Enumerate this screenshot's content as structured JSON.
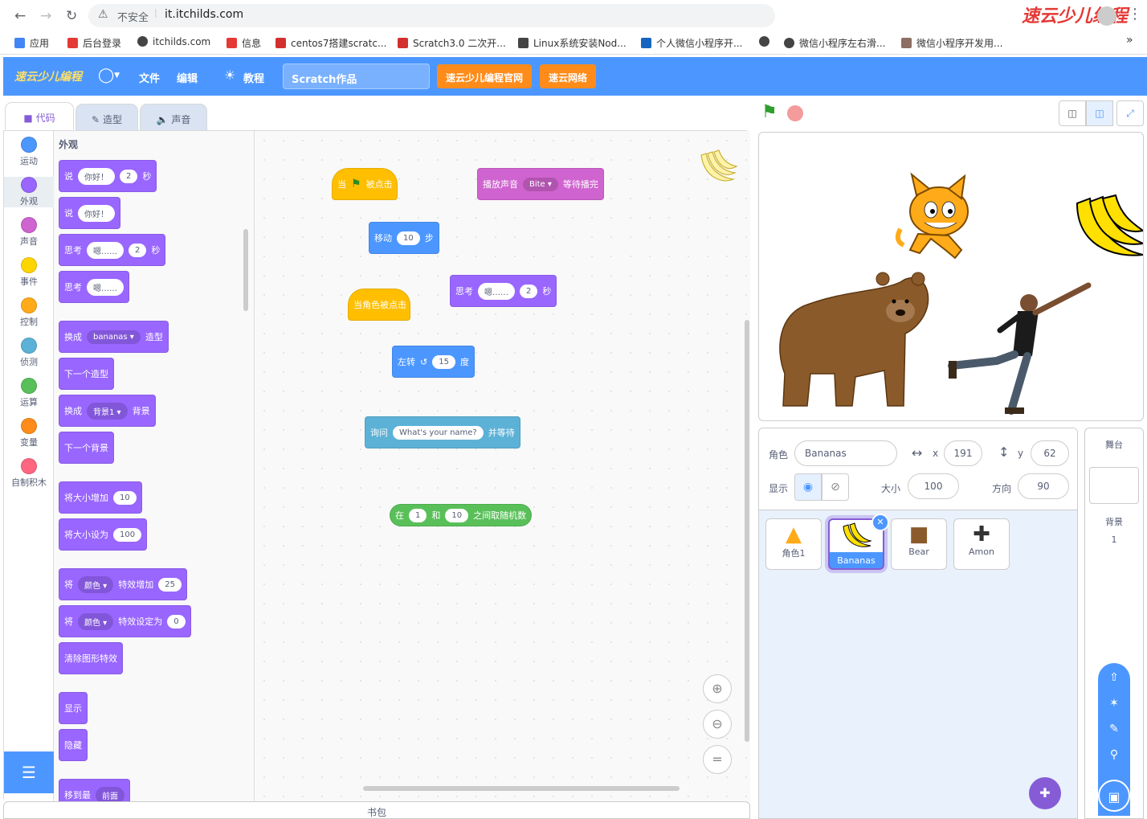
{
  "browser": {
    "security_label": "不安全",
    "url": "it.itchilds.com",
    "bookmarks": [
      {
        "label": "应用",
        "color": "#4285f4"
      },
      {
        "label": "后台登录",
        "color": "#e53935"
      },
      {
        "label": "itchilds.com",
        "color": "#444444"
      },
      {
        "label": "信息",
        "color": "#e53935"
      },
      {
        "label": "centos7搭建scratc...",
        "color": "#d32f2f"
      },
      {
        "label": "Scratch3.0 二次开...",
        "color": "#d32f2f"
      },
      {
        "label": "Linux系统安装Nod...",
        "color": "#444444"
      },
      {
        "label": "个人微信小程序开...",
        "color": "#1565c0"
      },
      {
        "label": "",
        "color": "#444444"
      },
      {
        "label": "微信小程序左右滑...",
        "color": "#444444"
      },
      {
        "label": "微信小程序开发用...",
        "color": "#8d6e63"
      }
    ],
    "more": "»",
    "brand_watermark": "速云少儿编程"
  },
  "menubar": {
    "logo": "速云少儿编程",
    "file": "文件",
    "edit": "编辑",
    "tutorials": "教程",
    "project_title": "Scratch作品",
    "official_site": "速云少儿编程官网",
    "network": "速云网络"
  },
  "tabs": {
    "code": "代码",
    "costumes": "造型",
    "sounds": "声音"
  },
  "categories": [
    {
      "label": "运动",
      "color": "#4c97ff"
    },
    {
      "label": "外观",
      "color": "#9966ff"
    },
    {
      "label": "声音",
      "color": "#cf63cf"
    },
    {
      "label": "事件",
      "color": "#ffd500"
    },
    {
      "label": "控制",
      "color": "#ffab19"
    },
    {
      "label": "侦测",
      "color": "#5cb1d6"
    },
    {
      "label": "运算",
      "color": "#59c059"
    },
    {
      "label": "变量",
      "color": "#ff8c1a"
    },
    {
      "label": "自制积木",
      "color": "#ff6680"
    }
  ],
  "palette": {
    "heading": "外观",
    "say_secs": {
      "a": "说",
      "v1": "你好！",
      "v2": "2",
      "b": "秒"
    },
    "say": {
      "a": "说",
      "v1": "你好！"
    },
    "think_secs": {
      "a": "思考",
      "v1": "嗯……",
      "v2": "2",
      "b": "秒"
    },
    "think": {
      "a": "思考",
      "v1": "嗯……"
    },
    "switch_costume": {
      "a": "换成",
      "v1": "bananas",
      "b": "造型"
    },
    "next_costume": "下一个造型",
    "switch_backdrop": {
      "a": "换成",
      "v1": "背景1",
      "b": "背景"
    },
    "next_backdrop": "下一个背景",
    "change_size": {
      "a": "将大小增加",
      "v1": "10"
    },
    "set_size": {
      "a": "将大小设为",
      "v1": "100"
    },
    "change_effect": {
      "a": "将",
      "v1": "颜色",
      "b": "特效增加",
      "v2": "25"
    },
    "set_effect": {
      "a": "将",
      "v1": "颜色",
      "b": "特效设定为",
      "v2": "0"
    },
    "clear_effects": "清除图形特效",
    "show": "显示",
    "hide": "隐藏",
    "goto_layer": {
      "a": "移到最",
      "v1": "前面"
    }
  },
  "workspace": {
    "flag_hat": {
      "a": "当",
      "b": "被点击"
    },
    "play_sound": {
      "a": "播放声音",
      "v1": "Bite",
      "b": "等待播完"
    },
    "move": {
      "a": "移动",
      "v1": "10",
      "b": "步"
    },
    "think": {
      "a": "思考",
      "v1": "嗯……",
      "v2": "2",
      "b": "秒"
    },
    "sprite_clicked": "当角色被点击",
    "turn_left": {
      "a": "左转",
      "v1": "15",
      "b": "度"
    },
    "ask": {
      "a": "询问",
      "v1": "What's your name?",
      "b": "并等待"
    },
    "random": {
      "a": "在",
      "v1": "1",
      "b": "和",
      "v2": "10",
      "c": "之间取随机数"
    }
  },
  "sprite_info": {
    "sprite_label": "角色",
    "sprite_name": "Bananas",
    "x_label": "x",
    "x": "191",
    "y_label": "y",
    "y": "62",
    "show_label": "显示",
    "size_label": "大小",
    "size": "100",
    "direction_label": "方向",
    "direction": "90"
  },
  "sprites": [
    {
      "name": "角色1",
      "icon": "cat-icon"
    },
    {
      "name": "Bananas",
      "icon": "banana-icon"
    },
    {
      "name": "Bear",
      "icon": "bear-icon"
    },
    {
      "name": "Amon",
      "icon": "dancer-icon"
    }
  ],
  "stage_panel": {
    "title": "舞台",
    "backdrops_label": "背景",
    "backdrops_count": "1"
  },
  "backpack": "书包"
}
